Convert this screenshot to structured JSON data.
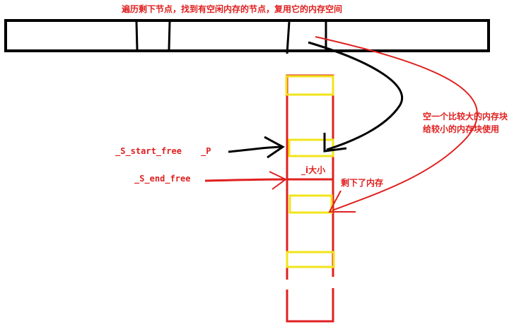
{
  "labels": {
    "top_caption": "遍历剩下节点，找到有空闲内存的节点，复用它的内存空间",
    "side_note_line1": "空一个比较大的内存块",
    "side_note_line2": "给较小的内存块使用",
    "start_free": "_S_start_free",
    "p": "_P",
    "end_free": "_S_end_free",
    "i_size": "_i大小",
    "remaining": "剩下了内存"
  },
  "colors": {
    "red": "#e02020",
    "black": "#000000",
    "yellow": "#f2e41a",
    "white": "#ffffff"
  }
}
